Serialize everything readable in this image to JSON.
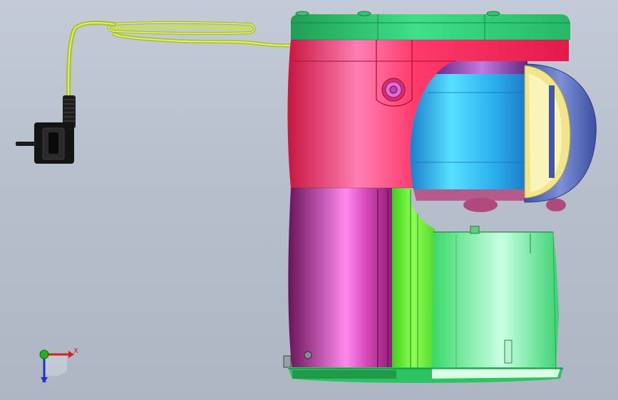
{
  "viewport": {
    "background_top": "#c4cbd6",
    "background_bottom": "#aeb6c3"
  },
  "model": {
    "parts": {
      "top_cap": {
        "color": "#22cc66",
        "icon": "top-cap-part"
      },
      "upper_housing": {
        "color": "#ee2255",
        "icon": "upper-housing-part"
      },
      "bearing_boss": {
        "color": "#cc55cc",
        "icon": "bearing-boss-part"
      },
      "motor_cylinder": {
        "color": "#33bbee",
        "icon": "motor-cylinder-part"
      },
      "bowl_ring": {
        "color": "#5a6fb8",
        "icon": "bowl-ring-part"
      },
      "bowl_liner": {
        "color": "#eee08a",
        "icon": "bowl-liner-part"
      },
      "lower_housing": {
        "color": "#c23aa8",
        "icon": "lower-housing-part"
      },
      "base_bracket": {
        "color": "#66e83a",
        "icon": "base-bracket-part"
      },
      "container": {
        "color": "#44e07a",
        "icon": "container-part"
      },
      "power_cord": {
        "color": "#c8e04a",
        "icon": "power-cord-part"
      },
      "plug": {
        "color": "#1a1a1a",
        "icon": "plug-part"
      }
    }
  },
  "triad": {
    "x_label": "X",
    "z_label": "Z",
    "x_color": "#d02020",
    "y_color": "#20b020",
    "z_color": "#2030c8"
  }
}
